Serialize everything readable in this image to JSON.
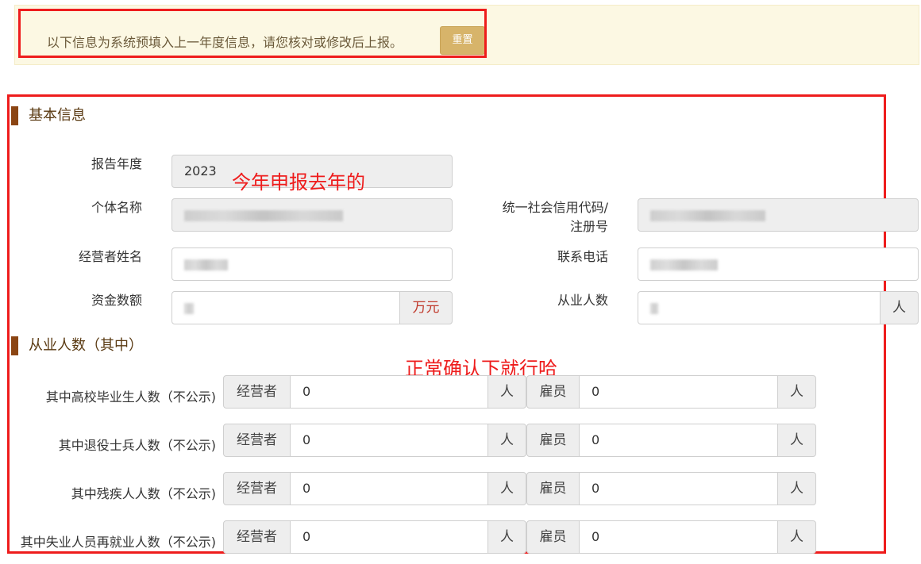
{
  "notice": {
    "text": "以下信息为系统预填入上一年度信息，请您核对或修改后上报。",
    "reset_label": "重置"
  },
  "basic": {
    "title": "基本信息",
    "report_year_label": "报告年度",
    "report_year_value": "2023",
    "name_label": "个体名称",
    "credit_code_label_1": "统一社会信用代码/",
    "credit_code_label_2": "注册号",
    "operator_label": "经营者姓名",
    "phone_label": "联系电话",
    "capital_label": "资金数额",
    "capital_unit": "万元",
    "employees_label": "从业人数",
    "employees_unit": "人"
  },
  "employment": {
    "title": "从业人数（其中）",
    "operator_label": "经营者",
    "employee_label": "雇员",
    "unit": "人",
    "rows": [
      {
        "label": "其中高校毕业生人数（不公示)",
        "operator_value": "0",
        "employee_value": "0"
      },
      {
        "label": "其中退役士兵人数（不公示)",
        "operator_value": "0",
        "employee_value": "0"
      },
      {
        "label": "其中残疾人人数（不公示)",
        "operator_value": "0",
        "employee_value": "0"
      },
      {
        "label": "其中失业人员再就业人数（不公示)",
        "operator_value": "0",
        "employee_value": "0"
      }
    ]
  },
  "annotations": {
    "year_note": "今年申报去年的",
    "confirm_note": "正常确认下就行哈"
  },
  "colors": {
    "accent": "#d7b46a",
    "section_bar": "#8b4513",
    "highlight": "#ee1c1c",
    "notice_bg": "#fcf8e3"
  }
}
